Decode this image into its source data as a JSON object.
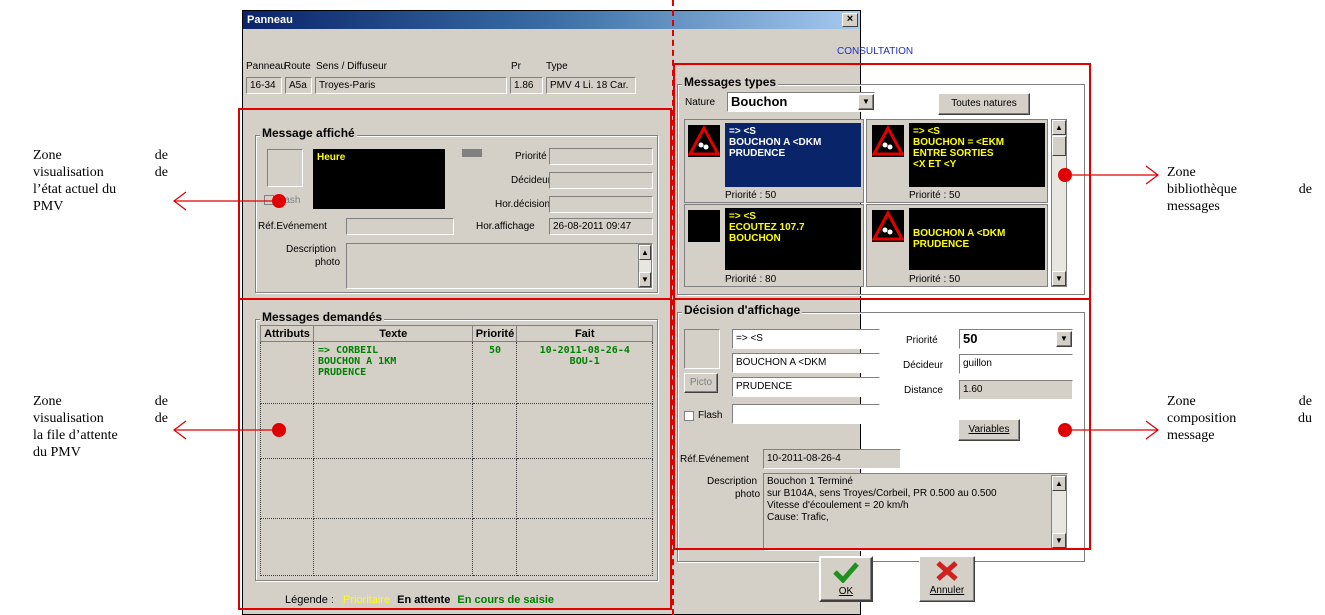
{
  "window": {
    "title": "Panneau",
    "close_glyph": "×",
    "mode": "CONSULTATION"
  },
  "panel_info": {
    "headers": {
      "panneau": "Panneau",
      "route": "Route",
      "sens": "Sens / Diffuseur",
      "pr": "Pr",
      "type": "Type"
    },
    "values": {
      "panneau": "16-34",
      "route": "A5a",
      "sens": "Troyes-Paris",
      "pr": "1.86",
      "type": "PMV  4 Li. 18 Car."
    }
  },
  "current_message": {
    "title": "Message affiché",
    "display_text": "Heure",
    "flash_label": "Flash",
    "priorite_label": "Priorité",
    "decideur_label": "Décideur",
    "hor_decision_label": "Hor.décision",
    "hor_affichage_label": "Hor.affichage",
    "hor_affichage_value": "26-08-2011 09:47",
    "ref_evenement_label": "Réf.Evénement",
    "description_label": "Description",
    "photo_label": "photo"
  },
  "queue": {
    "title": "Messages demandés",
    "columns": [
      "Attributs",
      "Texte",
      "Priorité",
      "Fait"
    ],
    "rows": [
      {
        "attributs": "",
        "texte": [
          "=> CORBEIL",
          "BOUCHON A 1KM",
          "PRUDENCE"
        ],
        "priorite": "50",
        "fait": [
          "10-2011-08-26-4",
          "BOU-1"
        ]
      }
    ],
    "legend_label": "Légende :",
    "legend_prioritaire": "Prioritaire",
    "legend_attente": "En attente",
    "legend_saisie": "En cours de saisie",
    "legend_colors": {
      "prioritaire": "#ffff00",
      "attente": "#000000",
      "saisie": "#008000"
    }
  },
  "library": {
    "title": "Messages types",
    "nature_label": "Nature",
    "nature_value": "Bouchon",
    "all_button": "Toutes natures",
    "cards": [
      {
        "lines": [
          "=> <S",
          "BOUCHON A <DKM",
          "PRUDENCE"
        ],
        "priority": "Priorité : 50",
        "has_sign": true,
        "selected": true
      },
      {
        "lines": [
          "=> <S",
          "BOUCHON = <EKM",
          "ENTRE SORTIES",
          "<X ET <Y"
        ],
        "priority": "Priorité : 50",
        "has_sign": true,
        "selected": false
      },
      {
        "lines": [
          "=> <S",
          "ECOUTEZ 107.7",
          "BOUCHON"
        ],
        "priority": "Priorité : 80",
        "has_sign": false,
        "selected": false
      },
      {
        "lines": [
          "BOUCHON A <DKM",
          "PRUDENCE"
        ],
        "priority": "Priorité : 50",
        "has_sign": true,
        "selected": false
      }
    ]
  },
  "composition": {
    "title": "Décision d'affichage",
    "lines": [
      "=> <S",
      "BOUCHON A <DKM",
      "PRUDENCE",
      ""
    ],
    "picto_button": "Picto",
    "flash_label": "Flash",
    "priorite_label": "Priorité",
    "priorite_value": "50",
    "decideur_label": "Décideur",
    "decideur_value": "guillon",
    "distance_label": "Distance",
    "distance_value": "1.60",
    "variables_button": "Variables",
    "ref_evenement_label": "Réf.Evénement",
    "ref_evenement_value": "10-2011-08-26-4",
    "description_label": "Description",
    "photo_label": "photo",
    "description_lines": [
      "Bouchon 1 Terminé",
      "sur B104A, sens Troyes/Corbeil,  PR 0.500 au 0.500",
      "Vitesse d'écoulement = 20 km/h",
      "Cause: Trafic,"
    ]
  },
  "buttons": {
    "ok": "OK",
    "annuler": "Annuler"
  },
  "annotations": {
    "left_top": [
      "Zone",
      "de",
      "visualisation",
      "de",
      "l’état actuel du",
      "PMV"
    ],
    "left_bottom": [
      "Zone",
      "de",
      "visualisation",
      "de",
      "la file d’attente",
      "du PMV"
    ],
    "right_top": [
      "Zone",
      "bibliothèque",
      "de",
      "messages"
    ],
    "right_bottom": [
      "Zone",
      "de",
      "composition",
      "du",
      "message"
    ]
  },
  "colors": {
    "annotation_red": "#e00000",
    "display_bg": "#000000",
    "display_text": "#ffff00",
    "selected_card": "#0a246a",
    "window_bg": "#d4d0c8"
  }
}
